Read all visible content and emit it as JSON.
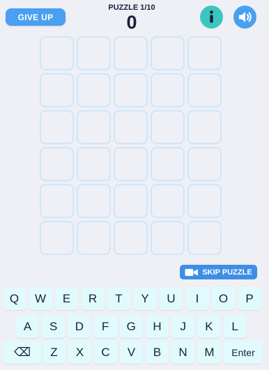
{
  "header": {
    "give_up_label": "GIVE UP",
    "puzzle_label": "PUZZLE 1/10",
    "score": "0",
    "info_icon": "info-icon",
    "sound_icon": "speaker-icon"
  },
  "board": {
    "columns": 5,
    "rows": 6,
    "letters": []
  },
  "skip_puzzle": {
    "label": "SKIP PUZZLE",
    "icon": "video-camera-icon"
  },
  "keyboard": {
    "row1": [
      "Q",
      "W",
      "E",
      "R",
      "T",
      "Y",
      "U",
      "I",
      "O",
      "P"
    ],
    "row2": [
      "A",
      "S",
      "D",
      "F",
      "G",
      "H",
      "J",
      "K",
      "L"
    ],
    "row3": [
      "⌫",
      "Z",
      "X",
      "C",
      "V",
      "B",
      "N",
      "M",
      "Enter"
    ]
  },
  "colors": {
    "background": "#eef0f6",
    "primary_blue": "#4a9ff0",
    "teal": "#3cc6c1",
    "tile_border": "#cfe6f7",
    "key_bg": "#e1fafb",
    "text_dark": "#1a1f3a"
  }
}
